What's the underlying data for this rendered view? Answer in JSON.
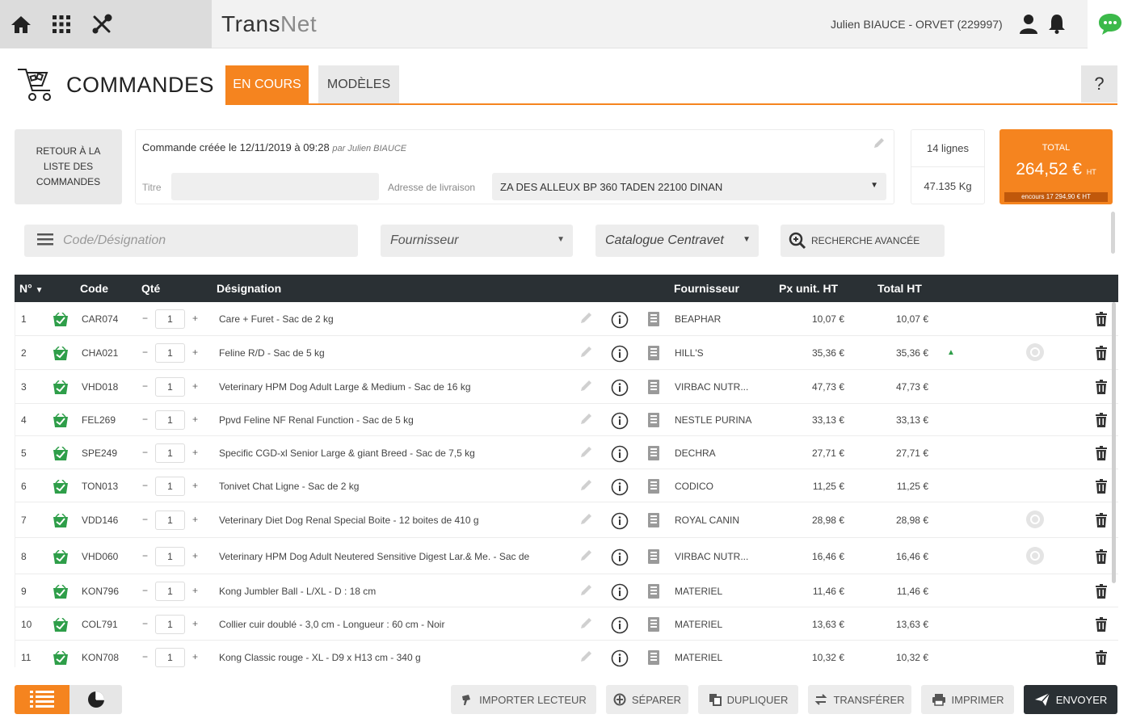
{
  "topbar": {
    "brand_trans": "Trans",
    "brand_net": "Net",
    "user": "Julien BIAUCE - ORVET (229997)"
  },
  "header": {
    "title": "COMMANDES",
    "tab_active": "EN COURS",
    "tab_models": "MODÈLES",
    "help": "?"
  },
  "order": {
    "back_label": "RETOUR À LA LISTE DES COMMANDES",
    "created": "Commande créée le 12/11/2019 à 09:28",
    "created_by": "par Julien BIAUCE",
    "title_label": "Titre",
    "title_value": "",
    "address_label": "Adresse de livraison",
    "address_value": "ZA DES ALLEUX BP 360 TADEN 22100 DINAN",
    "lines": "14 lignes",
    "weight": "47.135 Kg",
    "total_label": "TOTAL",
    "total_value": "264,52 €",
    "total_ht": "HT",
    "total_encours": "encours 17 294,90 € HT"
  },
  "filters": {
    "code_placeholder": "Code/Désignation",
    "supplier": "Fournisseur",
    "catalogue": "Catalogue Centravet",
    "advanced": "RECHERCHE AVANCÉE"
  },
  "table": {
    "headers": {
      "num": "N°",
      "code": "Code",
      "qty": "Qté",
      "designation": "Désignation",
      "supplier": "Fournisseur",
      "unit_price": "Px unit. HT",
      "total": "Total HT"
    },
    "rows": [
      {
        "num": "1",
        "code": "CAR074",
        "qty": "1",
        "des": "Care + Furet - Sac de 2 kg",
        "four": "BEAPHAR",
        "pu": "10,07 €",
        "tot": "10,07 €",
        "star": false,
        "circle": false
      },
      {
        "num": "2",
        "code": "CHA021",
        "qty": "1",
        "des": "Feline R/D - Sac de 5 kg",
        "four": "HILL'S",
        "pu": "35,36 €",
        "tot": "35,36 €",
        "star": true,
        "circle": true
      },
      {
        "num": "3",
        "code": "VHD018",
        "qty": "1",
        "des": "Veterinary HPM Dog Adult Large & Medium - Sac de 16 kg",
        "four": "VIRBAC NUTR...",
        "pu": "47,73 €",
        "tot": "47,73 €",
        "star": false,
        "circle": false
      },
      {
        "num": "4",
        "code": "FEL269",
        "qty": "1",
        "des": "Ppvd Feline NF Renal Function - Sac de 5 kg",
        "four": "NESTLE PURINA",
        "pu": "33,13 €",
        "tot": "33,13 €",
        "star": false,
        "circle": false
      },
      {
        "num": "5",
        "code": "SPE249",
        "qty": "1",
        "des": "Specific CGD-xl Senior Large & giant Breed - Sac de 7,5 kg",
        "four": "DECHRA",
        "pu": "27,71 €",
        "tot": "27,71 €",
        "star": false,
        "circle": false
      },
      {
        "num": "6",
        "code": "TON013",
        "qty": "1",
        "des": "Tonivet Chat Ligne - Sac de 2 kg",
        "four": "CODICO",
        "pu": "11,25 €",
        "tot": "11,25 €",
        "star": false,
        "circle": false
      },
      {
        "num": "7",
        "code": "VDD146",
        "qty": "1",
        "des": "Veterinary Diet Dog Renal Special Boite - 12 boites de 410 g",
        "four": "ROYAL CANIN",
        "pu": "28,98 €",
        "tot": "28,98 €",
        "star": false,
        "circle": true
      },
      {
        "num": "8",
        "code": "VHD060",
        "qty": "1",
        "des": "Veterinary HPM Dog Adult Neutered Sensitive Digest Lar.& Me. - Sac de",
        "four": "VIRBAC NUTR...",
        "pu": "16,46 €",
        "tot": "16,46 €",
        "star": false,
        "circle": true
      },
      {
        "num": "9",
        "code": "KON796",
        "qty": "1",
        "des": "Kong Jumbler Ball - L/XL - D : 18 cm",
        "four": "MATERIEL",
        "pu": "11,46 €",
        "tot": "11,46 €",
        "star": false,
        "circle": false
      },
      {
        "num": "10",
        "code": "COL791",
        "qty": "1",
        "des": "Collier cuir doublé - 3,0 cm - Longueur : 60 cm - Noir",
        "four": "MATERIEL",
        "pu": "13,63 €",
        "tot": "13,63 €",
        "star": false,
        "circle": false
      },
      {
        "num": "11",
        "code": "KON708",
        "qty": "1",
        "des": "Kong Classic rouge - XL - D9 x H13 cm - 340 g",
        "four": "MATERIEL",
        "pu": "10,32 €",
        "tot": "10,32 €",
        "star": false,
        "circle": false
      }
    ]
  },
  "bottom": {
    "import": "IMPORTER LECTEUR",
    "split": "SÉPARER",
    "duplicate": "DUPLIQUER",
    "transfer": "TRANSFÉRER",
    "print": "IMPRIMER",
    "send": "ENVOYER"
  },
  "colors": {
    "accent": "#f5841f",
    "dark": "#2a3034",
    "cart_green": "#2e9e49"
  }
}
